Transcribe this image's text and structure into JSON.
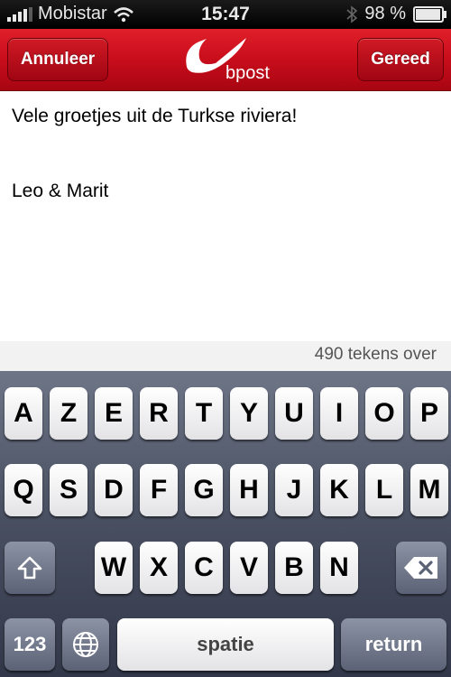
{
  "status": {
    "carrier": "Mobistar",
    "time": "15:47",
    "battery": "98 %",
    "battery_level": 0.98
  },
  "nav": {
    "cancel_label": "Annuleer",
    "done_label": "Gereed",
    "logo_text": "bpost"
  },
  "message": {
    "line1": "Vele groetjes uit de Turkse riviera!",
    "line2": "Leo & Marit"
  },
  "counter": "490 tekens over",
  "keyboard": {
    "row1": [
      "A",
      "Z",
      "E",
      "R",
      "T",
      "Y",
      "U",
      "I",
      "O",
      "P"
    ],
    "row2": [
      "Q",
      "S",
      "D",
      "F",
      "G",
      "H",
      "J",
      "K",
      "L",
      "M"
    ],
    "row3": [
      "W",
      "X",
      "C",
      "V",
      "B",
      "N"
    ],
    "numbers_label": "123",
    "space_label": "spatie",
    "return_label": "return"
  }
}
